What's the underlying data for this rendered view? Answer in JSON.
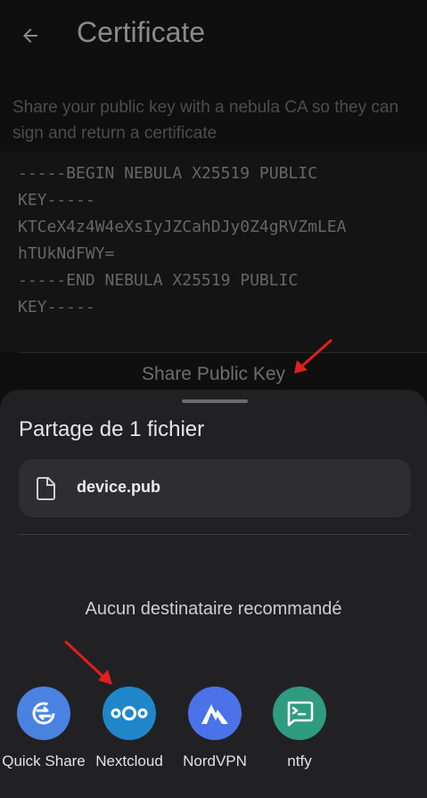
{
  "app": {
    "title": "Certificate",
    "description": "Share your public key with a nebula CA so they can sign and return a certificate",
    "public_key_lines": [
      "-----BEGIN NEBULA X25519 PUBLIC",
      "KEY-----",
      "KTCeX4z4W4eXsIyJZCahDJy0Z4gRVZmLEA",
      "hTUkNdFWY=",
      "-----END NEBULA X25519 PUBLIC",
      "KEY-----"
    ],
    "share_button": "Share Public Key"
  },
  "sheet": {
    "title": "Partage de 1 fichier",
    "file_name": "device.pub",
    "no_recommendations": "Aucun destinataire recommandé",
    "targets": [
      {
        "name": "quick-share",
        "label": "Quick Share",
        "color": "#4a82e0",
        "icon": "quick-share-icon"
      },
      {
        "name": "nextcloud",
        "label": "Nextcloud",
        "color": "#1f86c9",
        "icon": "nextcloud-icon"
      },
      {
        "name": "nordvpn",
        "label": "NordVPN",
        "color": "#4b72e8",
        "icon": "nordvpn-icon"
      },
      {
        "name": "ntfy",
        "label": "ntfy",
        "color": "#2f9b80",
        "icon": "ntfy-icon"
      }
    ]
  },
  "colors": {
    "annotation_arrow": "#e01f1f",
    "sheet_background": "#212123"
  }
}
